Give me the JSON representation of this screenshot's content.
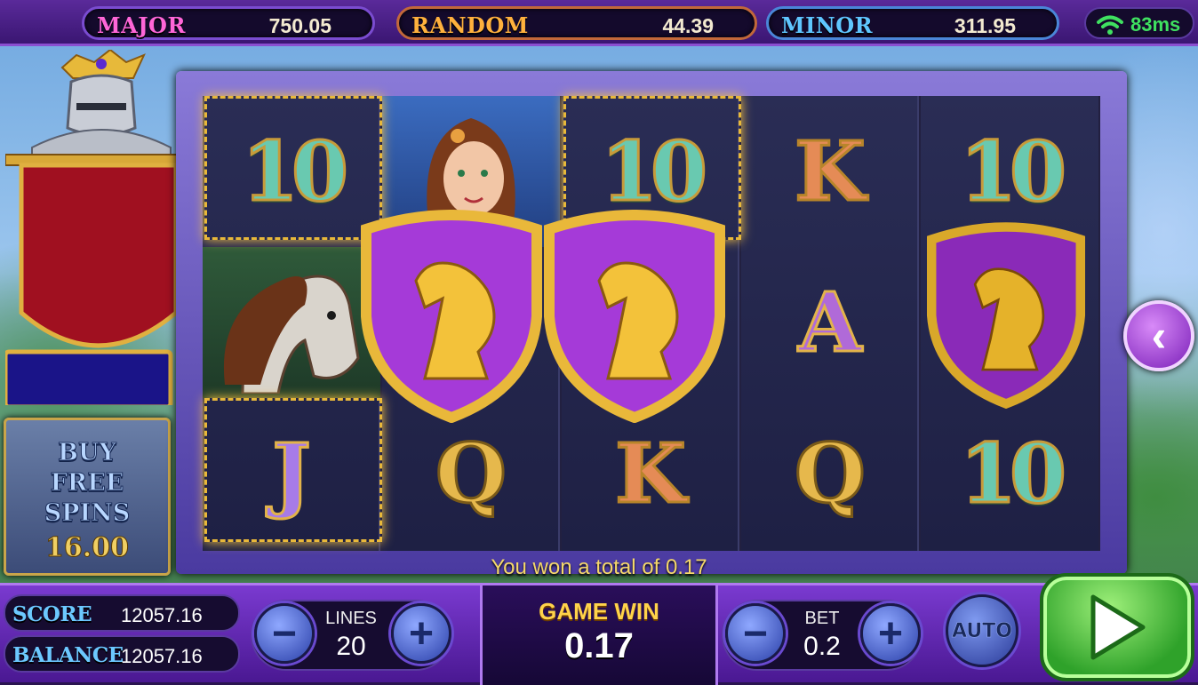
{
  "jackpots": {
    "major": {
      "label": "MAJOR",
      "value": "750.05"
    },
    "random": {
      "label": "RANDOM",
      "value": "44.39"
    },
    "minor": {
      "label": "MINOR",
      "value": "311.95"
    }
  },
  "network": {
    "ping": "83ms",
    "icon": "wifi-icon",
    "color": "#3fe060"
  },
  "buy_free_spins": {
    "line1": "BUY",
    "line2": "FREE",
    "line3": "SPINS",
    "price": "16.00"
  },
  "reels": [
    [
      "10",
      "horse-portrait",
      "J"
    ],
    [
      "princess-portrait",
      "horse-shield",
      "Q"
    ],
    [
      "10",
      "horse-shield",
      "K"
    ],
    [
      "K",
      "A",
      "Q"
    ],
    [
      "10",
      "horse-shield",
      "10"
    ]
  ],
  "win_message": "You won a total of 0.17",
  "bottom": {
    "score_label": "SCORE",
    "score_value": "12057.16",
    "balance_label": "BALANCE",
    "balance_value": "12057.16",
    "lines_label": "LINES",
    "lines_value": "20",
    "game_win_label": "GAME WIN",
    "game_win_value": "0.17",
    "bet_label": "BET",
    "bet_value": "0.2",
    "auto_label": "AUTO",
    "minus_symbol": "−",
    "plus_symbol": "+"
  },
  "icons": {
    "side_nav": "chevron-left-icon",
    "spin": "play-icon"
  },
  "colors": {
    "accent": "#7a3ad0",
    "gold": "#f5d86a",
    "spin": "#2fa22a"
  }
}
